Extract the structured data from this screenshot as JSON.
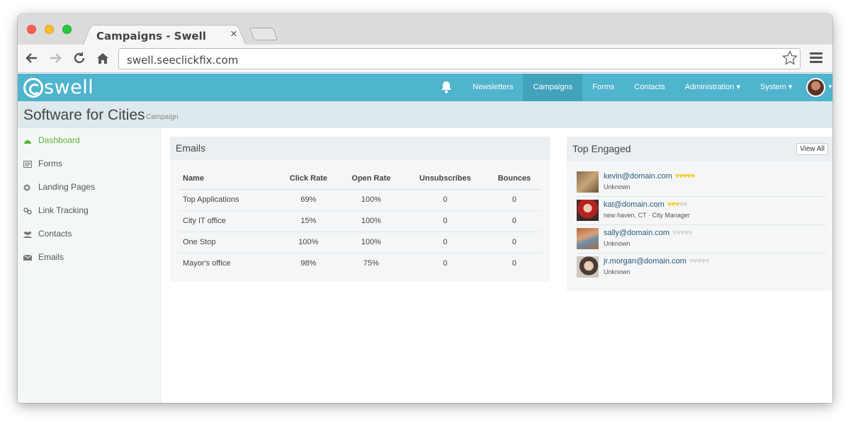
{
  "browser": {
    "tab_title": "Campaigns - Swell",
    "tab_close": "×",
    "url": "swell.seeclickfix.com"
  },
  "app": {
    "logo_text": "swell",
    "nav": [
      {
        "label": "Newsletters",
        "active": false
      },
      {
        "label": "Campaigns",
        "active": true
      },
      {
        "label": "Forms",
        "active": false
      },
      {
        "label": "Contacts",
        "active": false
      },
      {
        "label": "Administration ▾",
        "active": false
      },
      {
        "label": "System ▾",
        "active": false
      }
    ],
    "brand_color": "#4fb4cd"
  },
  "page": {
    "title": "Software for Cities",
    "subtitle": "Campaign"
  },
  "sidebar": {
    "items": [
      {
        "label": "Dashboard",
        "icon": "dashboard-icon",
        "active": true
      },
      {
        "label": "Forms",
        "icon": "forms-icon",
        "active": false
      },
      {
        "label": "Landing Pages",
        "icon": "landing-pages-icon",
        "active": false
      },
      {
        "label": "Link Tracking",
        "icon": "link-icon",
        "active": false
      },
      {
        "label": "Contacts",
        "icon": "contacts-icon",
        "active": false
      },
      {
        "label": "Emails",
        "icon": "envelope-icon",
        "active": false
      }
    ]
  },
  "emails": {
    "heading": "Emails",
    "columns": [
      "Name",
      "Click Rate",
      "Open Rate",
      "Unsubscribes",
      "Bounces"
    ],
    "rows": [
      [
        "Top Applications",
        "69%",
        "100%",
        "0",
        "0"
      ],
      [
        "City IT office",
        "15%",
        "100%",
        "0",
        "0"
      ],
      [
        "One Stop",
        "100%",
        "100%",
        "0",
        "0"
      ],
      [
        "Mayor's office",
        "98%",
        "75%",
        "0",
        "0"
      ]
    ]
  },
  "engaged": {
    "heading": "Top Engaged",
    "view_all": "View All",
    "contacts": [
      {
        "email": "kevin@domain.com",
        "detail": "Unknown",
        "hearts": 5
      },
      {
        "email": "kat@domain.com",
        "detail": "new haven, CT · City Manager",
        "hearts": 3
      },
      {
        "email": "sally@domain.com",
        "detail": "Unknown",
        "hearts": 0
      },
      {
        "email": "jr.morgan@domain.com",
        "detail": "Unknown",
        "hearts": 0
      }
    ]
  }
}
